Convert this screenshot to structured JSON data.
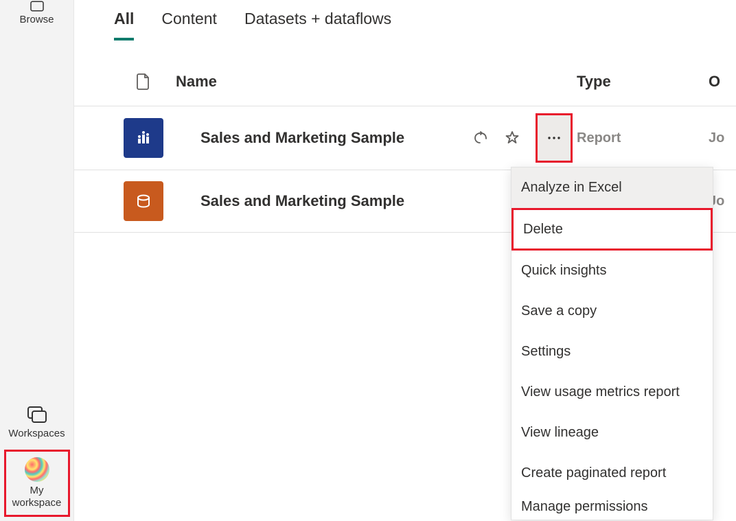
{
  "sidebar": {
    "browse": {
      "label": "Browse"
    },
    "workspaces": {
      "label": "Workspaces"
    },
    "my_workspace": {
      "label": "My\nworkspace"
    }
  },
  "tabs": [
    {
      "label": "All",
      "active": true
    },
    {
      "label": "Content",
      "active": false
    },
    {
      "label": "Datasets + dataflows",
      "active": false
    }
  ],
  "table": {
    "headers": {
      "name": "Name",
      "type": "Type",
      "last": "O"
    },
    "rows": [
      {
        "icon": "report",
        "name": "Sales and Marketing Sample",
        "type": "Report",
        "last": "Jo"
      },
      {
        "icon": "dataset",
        "name": "Sales and Marketing Sample",
        "type": "",
        "last": "Jo"
      }
    ]
  },
  "context_menu": [
    {
      "label": "Analyze in Excel",
      "hovered": true
    },
    {
      "label": "Delete",
      "highlighted": true
    },
    {
      "label": "Quick insights"
    },
    {
      "label": "Save a copy"
    },
    {
      "label": "Settings"
    },
    {
      "label": "View usage metrics report"
    },
    {
      "label": "View lineage"
    },
    {
      "label": "Create paginated report"
    },
    {
      "label": "Manage permissions"
    }
  ]
}
